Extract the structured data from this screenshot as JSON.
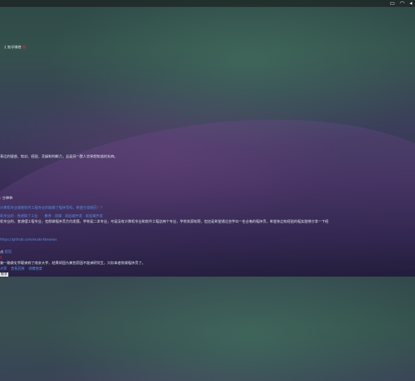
{
  "tray": {
    "icons": [
      "window-icon",
      "wifi-icon",
      "volume-icon"
    ]
  },
  "terminal": {
    "title_prefix": "1 ",
    "title": "知乎推荐",
    "title_badge": "热",
    "answer_intro": "事过的疑惑、知识、经验、见解和判断力，总是另一群人非常想知道的东西。",
    "section_label": ": 分神帝",
    "question": "计算机专业或者软件工程专业的能做了程序员吗，希望分享经历！？",
    "tags": [
      "机专业的 · 普通除了工业",
      "教育 · 前端 · 前后端开发 · 前后端开发"
    ],
    "answer": "机专业的，普通理工程专业，但想做程序员方向发展。学校是二本专业，可是没有计算机专业和软件工程这两个专业，学校资源有限，但还是希望通过自学出一名合格的程序员，希望身边有经验的程友能够分享一下经",
    "link": "https://github.com/ecob-libraries",
    "vote_prefix": "点",
    "vote_label": "赞同",
    "vote_num": "1",
    "footer_comment": "第一路做化学跟读到了南京大学，结果却因为某些原因不能读研究生，只好来者软做程序员了。",
    "nav": [
      "点赞",
      "查看回答",
      "收藏答案"
    ],
    "prompt": "知乎"
  },
  "colors": {
    "accent_red": "#d33",
    "link_blue": "#5a8fe0"
  }
}
